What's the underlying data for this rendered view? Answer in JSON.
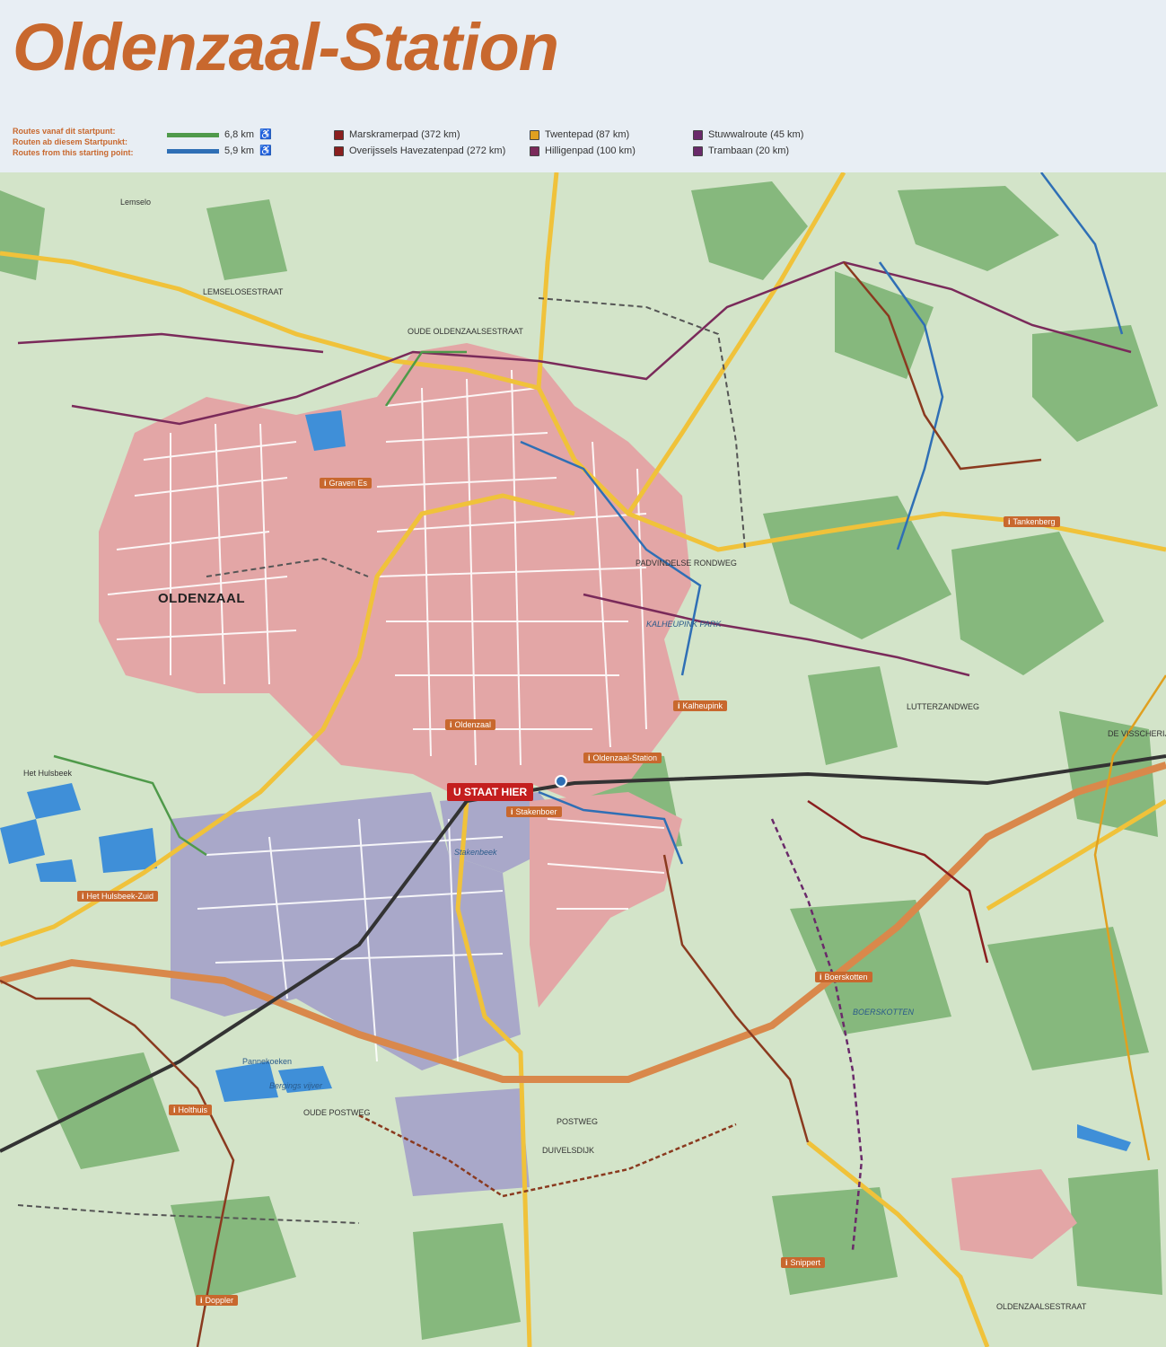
{
  "title": "Oldenzaal-Station",
  "intro": [
    "Routes vanaf dit startpunt:",
    "Routen ab diesem Startpunkt:",
    "Routes from this starting point:"
  ],
  "colors": {
    "green_route": "#4f9a4a",
    "blue_route": "#2f6fb5",
    "title": "#c8682e",
    "here": "#c41e1e",
    "grass": "#cfe2c6",
    "forest": "#7fb477",
    "town": "#e3a6a6",
    "industry": "#a9a8c9",
    "water": "#3f8fd8"
  },
  "legend": {
    "walk_routes": [
      {
        "length": "6,8 km",
        "color": "#4f9a4a",
        "icon": "pram-icon"
      },
      {
        "length": "5,9 km",
        "color": "#2f6fb5",
        "icon": "pram-icon"
      }
    ],
    "col2": [
      {
        "label": "Marskramerpad (372 km)",
        "color": "#8a1f1f"
      },
      {
        "label": "Overijssels Havezatenpad (272 km)",
        "color": "#8a1f1f"
      }
    ],
    "col3": [
      {
        "label": "Twentepad (87 km)",
        "color": "#e0a020"
      },
      {
        "label": "Hilligenpad (100 km)",
        "color": "#7a2a5a"
      }
    ],
    "col4": [
      {
        "label": "Stuwwalroute (45 km)",
        "color": "#6a2a6a"
      },
      {
        "label": "Trambaan (20 km)",
        "color": "#6a2a6a"
      }
    ]
  },
  "map": {
    "town": "OLDENZAAL",
    "here_label": "U STAAT HIER",
    "start_points": [
      "Graven Es",
      "Oldenzaal",
      "Oldenzaal-Station",
      "Stakenboer",
      "Kalheupink",
      "Tankenberg",
      "Het Hulsbeek-Zuid",
      "Boerskotten",
      "Holthuis",
      "Snippert",
      "Doppler"
    ],
    "places": [
      "Lemselo",
      "Het Hulsbeek",
      "BOERSKOTTEN",
      "KALHEUPINK PARK",
      "Pannekoeken plas",
      "Bergings vijver",
      "Stakenbeek"
    ],
    "streets": [
      "LEMSELOSESTRAAT",
      "OUDE OLDENZAALSESTRAAT",
      "PADVINDELSE RONDWEG",
      "POSTWEG",
      "OUDE POSTWEG",
      "DUIVELSDIJK",
      "OLDENZAALSESTRAAT",
      "LUTTERZANDWEG",
      "DE VISSCHERIJ"
    ]
  }
}
